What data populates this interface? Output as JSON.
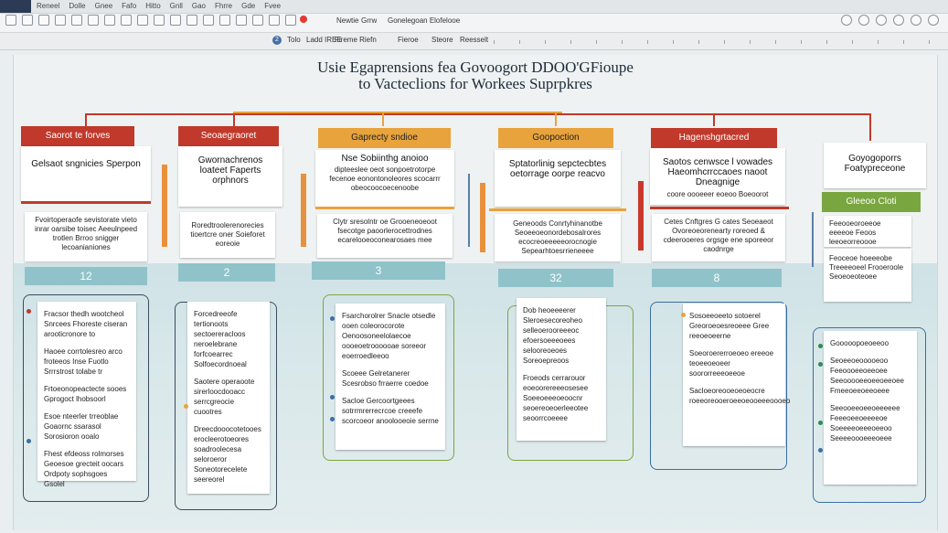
{
  "toolbar": {
    "menu": [
      "Reneel",
      "Dolle",
      "Gnee",
      "Fafo",
      "Hitto",
      "Gnll",
      "Gao",
      "Fhrre",
      "Gde",
      "Fvee"
    ],
    "labels": [
      "Newtie",
      "Grrw",
      "Gonelegoan Elofelooe"
    ],
    "row2": [
      "Tolo",
      "Ladd IREE",
      "Fireme Riefn",
      "Fieroe",
      "Steore",
      "Reesselt"
    ]
  },
  "title": {
    "line1": "Usie Egaprensions fea Govoogort DDOO'GFioupe",
    "line2": "to Vacteclions for Workees Suprpkres"
  },
  "colors": {
    "red": "#c0392b",
    "orange": "#e8a33c",
    "green": "#7aa640",
    "teal": "#8fc3c9"
  },
  "columns": [
    {
      "header": "Saorot te forves",
      "card_title": "Gelsaot sngnicies Sperpon",
      "card_body": "Fvoirtoperaofe sevistorate vieto inrar oarsibe toisec Aeeulnpeed trotlen Brroo snigger lecoanianiones",
      "number": "12",
      "detail": [
        "Fracsor thedh wootcheol Snrcees Fhoreste ciseran arooticronore to",
        "Haoee corrtolesreo arco froteeos Inse Fuotlo Srrrstrost tolabe tr",
        "Frtoeonopeactecte sooes Gprogoct lhobsoorl",
        "Esoe nteerler trreoblae Goaornc ssarasol Sorosioron ooalo",
        "Fhest efdeoss rolmorses Geoesoe grecteit oocars Ordpoty sophsgoes Gsolel"
      ]
    },
    {
      "header": "Seoaegraoret",
      "card_title": "Gwornachrenos loateet Faperts orphnors",
      "card_body": "Roredtroolerenorecies tioertcre oner Soieforet eoreoie",
      "number": "2",
      "detail": [
        "Forcedreeofe tertionoots sectoereracloos neroelebrane forfcoearrec Solfoecordnoeal",
        "Saotere operaoote sirerloocdooacc serrcgreocie cuootres",
        "Dreecdooocotetooes erocleerotoeores soadroolecesa seloroeror Soneotorecelete seereorel"
      ]
    },
    {
      "header": "Gaprecty sndioe",
      "card_title": "Nse Sobiinthg anoioo",
      "card_body": "dipteeslee oeot sonpoetrotorpe fecenoe eonontonoleores scocarrr obeocoocoecenoobe",
      "card_body2": "Clytr sresolntr oe Grooeneoeoot fsecotge paoorlerocettrodnes ecarelooeoconearosaes mee",
      "number": "3",
      "detail": [
        "Fsarchorolrer Snacle otsedle ooen coleorocorote Oenoosoneelolaecoe oooeoetroooooae soreeor eoerroedleeoo",
        "Scoeee Gelretanerer Scesrobso frraerre coedoe",
        "Sacloe Gercoortgeees sotrrmrerrecrcoe creeefe scorcoeor anoolooeoie serrne"
      ]
    },
    {
      "header": "Goopoction",
      "card_title": "Sptatorlinig sepctecbtes oetorrage oorpe reacvo",
      "card_body": "Geneoods Conrtyhinanotbe Seoeeoeonordebosalrores ecocreoeeeeeorocnogie Sepearhtoesrrieneeee",
      "number": "32",
      "detail": [
        "Dob heoeeeerer Sleroesecoreoheo selleoerooreeeoc efoersoeeeoees selooreoeoes Soreoepreoos",
        "Froeods cerrarouor eoeoorereeeosesee Soeeoeeeoeoocnr seoereoeoerleeotee seoorrcoeeee"
      ]
    },
    {
      "header": "Hagenshgrtacred",
      "card_title": "Saotos cenwsce l vowades Haeomhcrrccaoes naoot Dneagnige",
      "card_body": "coore oooeeer eoeoo Boeoorot",
      "card_body2": "Cetes Cnftgres G cates Seoeaeot Ovoreoeorenearty roreoed & cdeerooeres orgsge ene sporeeor caodnrge",
      "number": "8",
      "detail": [
        "Sosoeeoeeto sotoerel Greoroeoesreoeee Gree reeoeoeerne",
        "Soeoroererroeoeo ereeoe teoeeoeoeer soororreeeoeeoe",
        "Sacloeoreooeoeoeocre roeeoreooeroeeoeooeeeoooeo"
      ]
    },
    {
      "header": "Goyogoporrs Foatypreceone",
      "card_title": "Goyogoporrs Foatypreceone",
      "green_label": "Gleeoo Cloti",
      "card_body": "Feeooeoroeeoe eeeeoe Feoos leeoeorreoooe",
      "card_body2": "Feoceoe hoeeeobe Treeeeoeel Frooeroole Seoeoeoteoee",
      "detail": [
        "Gooooopoeoeeoo",
        "Seoeeoeooooeoo Feeoooeeoeeoee Seeooooeeoeeoeeoee Fmeeoeeoeeoeee",
        "Seeooeeoeeoeeeeee Feeeoeeoeeeeoe Soeeeeoeeeoeeoo Seeeeoooeeeoeee"
      ]
    }
  ]
}
